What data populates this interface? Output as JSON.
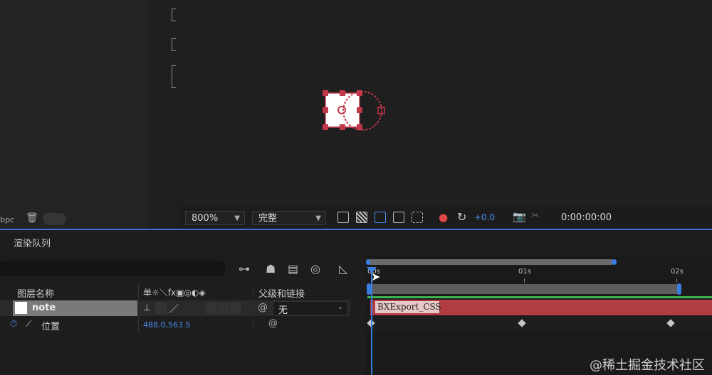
{
  "left_panel": {
    "bpc": "bpc"
  },
  "viewer": {
    "zoom": "800%",
    "resolution": "完整",
    "exposure": "+0.0",
    "timecode": "0:00:00:00"
  },
  "render_queue": {
    "label": "渲染队列"
  },
  "layers_header": {
    "name_col": "图层名称",
    "switches": "单☼＼fx▣◎◐◈",
    "parent_col": "父级和链接"
  },
  "layer": {
    "name": "note",
    "parent": "无"
  },
  "property": {
    "name": "位置",
    "value": "488.0,563.5"
  },
  "timeline": {
    "ruler": [
      "00s",
      "01s",
      "02s"
    ],
    "layer_bar_label": "BXExport_CSS"
  },
  "watermark": "@稀土掘金技术社区",
  "colors": {
    "accent": "#3a7de0",
    "layer_bar": "#b23c44",
    "label_green": "#3fb04a"
  }
}
